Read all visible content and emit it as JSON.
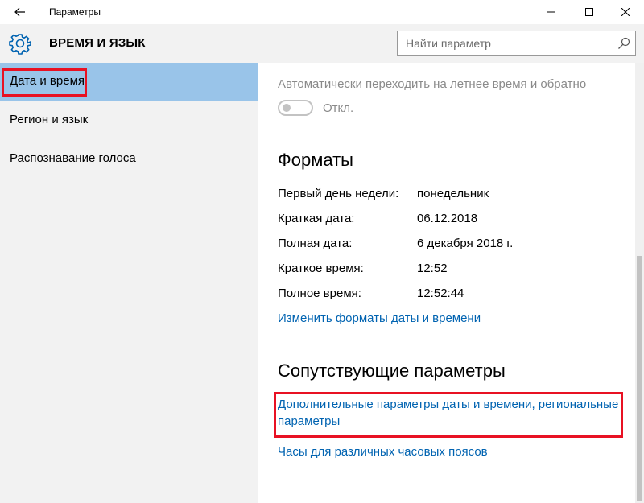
{
  "window": {
    "title": "Параметры",
    "back_icon": "arrow-left-icon",
    "controls": [
      "minimize-icon",
      "maximize-icon",
      "close-icon"
    ]
  },
  "header": {
    "section_icon": "gear-icon",
    "section_title": "ВРЕМЯ И ЯЗЫК",
    "search_placeholder": "Найти параметр",
    "search_icon": "search-icon"
  },
  "sidebar": {
    "items": [
      {
        "label": "Дата и время",
        "selected": true
      },
      {
        "label": "Регион и язык",
        "selected": false
      },
      {
        "label": "Распознавание голоса",
        "selected": false
      }
    ]
  },
  "main": {
    "dst": {
      "label": "Автоматически переходить на летнее время и обратно",
      "toggle_state": "Откл."
    },
    "formats": {
      "heading": "Форматы",
      "rows": [
        {
          "label": "Первый день недели:",
          "value": "понедельник"
        },
        {
          "label": "Краткая дата:",
          "value": "06.12.2018"
        },
        {
          "label": "Полная дата:",
          "value": "6 декабря 2018 г."
        },
        {
          "label": "Краткое время:",
          "value": "12:52"
        },
        {
          "label": "Полное время:",
          "value": "12:52:44"
        }
      ],
      "change_link": "Изменить форматы даты и времени"
    },
    "related": {
      "heading": "Сопутствующие параметры",
      "additional_link_line1": "Дополнительные параметры даты и времени, региональные",
      "additional_link_line2": "параметры",
      "clocks_link": "Часы для различных часовых поясов"
    }
  },
  "colors": {
    "accent": "#0063b1",
    "selection": "#99c4e9",
    "highlight_box": "#e81123",
    "pane_bg": "#f2f2f2"
  }
}
